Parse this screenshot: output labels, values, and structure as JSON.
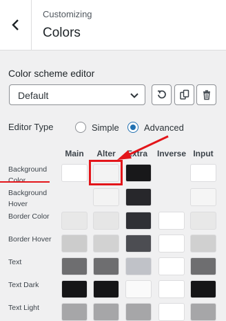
{
  "header": {
    "breadcrumb": "Customizing",
    "title": "Colors",
    "back_icon": "chevron-left-icon"
  },
  "scheme_editor": {
    "label": "Color scheme editor",
    "selected": "Default",
    "buttons": [
      "reset-icon",
      "duplicate-icon",
      "delete-icon"
    ]
  },
  "editor_type": {
    "label": "Editor Type",
    "options": [
      "Simple",
      "Advanced"
    ],
    "selected": "Advanced"
  },
  "table": {
    "columns": [
      "Main",
      "Alter",
      "Extra",
      "Inverse",
      "Input"
    ],
    "rows": [
      {
        "label": "Background Color",
        "swatches": [
          "#ffffff",
          "#f3f3f3",
          "#18181a",
          null,
          "#ffffff"
        ]
      },
      {
        "label": "Background Hover",
        "swatches": [
          null,
          "#f3f3f3",
          "#27272b",
          null,
          "#f5f5f5"
        ]
      },
      {
        "label": "Border Color",
        "swatches": [
          "#e8e8e8",
          "#e6e6e6",
          "#2f3035",
          "#ffffff",
          "#e8e8e8"
        ]
      },
      {
        "label": "Border Hover",
        "swatches": [
          "#cccccc",
          "#d2d2d2",
          "#4c4d52",
          "#ffffff",
          "#d0d0d0"
        ]
      },
      {
        "label": "Text",
        "swatches": [
          "#6e6e70",
          "#6e6e70",
          "#c0c2c8",
          "#ffffff",
          "#6e6e70"
        ]
      },
      {
        "label": "Text Dark",
        "swatches": [
          "#151517",
          "#151517",
          "#fafafa",
          "#ffffff",
          "#151517"
        ]
      },
      {
        "label": "Text Light",
        "swatches": [
          "#a6a6a8",
          "#a6a6a8",
          "#a6a6a8",
          "#ffffff",
          "#a6a6a8"
        ]
      }
    ]
  },
  "colors": {
    "accent": "#2271b1",
    "annotation": "#e3151a"
  }
}
